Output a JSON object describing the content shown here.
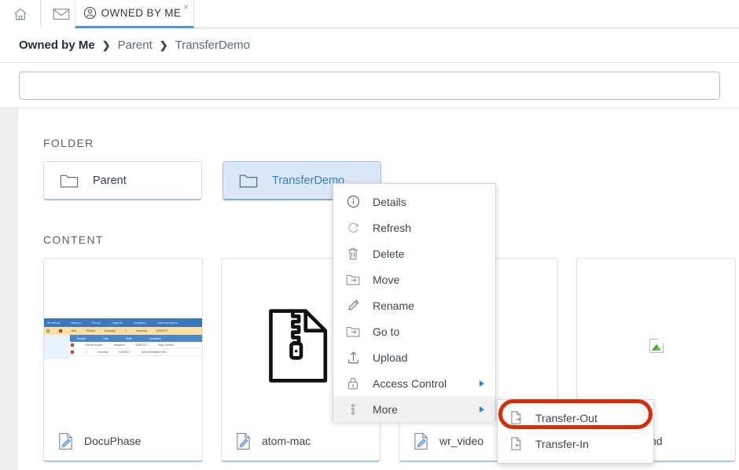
{
  "tabbar": {
    "home_icon": "home-icon",
    "mail_icon": "envelope-icon",
    "active_tab": {
      "icon": "user-circle-icon",
      "label": "OWNED BY ME",
      "close": "×"
    }
  },
  "breadcrumb": {
    "items": [
      "Owned by Me",
      "Parent",
      "TransferDemo"
    ],
    "separator": "❯"
  },
  "search": {
    "value": "",
    "placeholder": ""
  },
  "sections": {
    "folder_title": "FOLDER",
    "content_title": "CONTENT"
  },
  "folders": [
    {
      "name": "Parent",
      "icon": "folder-icon",
      "selected": false
    },
    {
      "name": "TransferDemo",
      "icon": "folder-icon",
      "selected": true
    }
  ],
  "content_items": [
    {
      "name": "DocuPhase",
      "icon": "document-edit-icon",
      "thumb": "screenshot-thumbnail"
    },
    {
      "name": "atom-mac",
      "icon": "document-edit-icon",
      "thumb": "zip-file-icon"
    },
    {
      "name": "wr_video",
      "icon": "document-edit-icon",
      "thumb": "none"
    },
    {
      "name": "ckground",
      "icon": "document-edit-icon",
      "thumb": "broken-image-icon"
    }
  ],
  "thumbnail": {
    "nav_items": [
      "Workflow",
      "Search",
      "Forms",
      "Capture",
      "Analytics",
      "Administration"
    ],
    "highlight_row": [
      "Add",
      "TATest3",
      "Drawings",
      "1",
      "Incoming",
      "6/26/2017",
      "1"
    ],
    "table_headers": [
      "Version",
      "User",
      "Date",
      "Comment"
    ],
    "table_rows": [
      [
        "Current Version",
        "sysadmin",
        "6/26/2017",
        "Auto CheckIn"
      ],
      [
        "1",
        "Incoming",
        "6/26/2017",
        "Auto Generated Versi."
      ]
    ]
  },
  "context_menu": {
    "items": [
      {
        "label": "Details",
        "icon": "info-circle-icon",
        "submenu": false,
        "active": false
      },
      {
        "label": "Refresh",
        "icon": "refresh-icon",
        "submenu": false,
        "active": false
      },
      {
        "label": "Delete",
        "icon": "trash-icon",
        "submenu": false,
        "active": false
      },
      {
        "label": "Move",
        "icon": "folder-arrow-icon",
        "submenu": false,
        "active": false
      },
      {
        "label": "Rename",
        "icon": "pencil-icon",
        "submenu": false,
        "active": false
      },
      {
        "label": "Go to",
        "icon": "folder-arrow-icon",
        "submenu": false,
        "active": false
      },
      {
        "label": "Upload",
        "icon": "upload-icon",
        "submenu": false,
        "active": false
      },
      {
        "label": "Access Control",
        "icon": "lock-icon",
        "submenu": true,
        "active": false
      },
      {
        "label": "More",
        "icon": "vertical-dots-icon",
        "submenu": true,
        "active": true
      }
    ]
  },
  "submenu": {
    "items": [
      {
        "label": "Transfer-Out",
        "icon": "document-out-icon",
        "highlighted": true
      },
      {
        "label": "Transfer-In",
        "icon": "document-in-icon",
        "highlighted": false
      }
    ]
  },
  "colors": {
    "accent_blue": "#2f7ec4",
    "tab_underline": "#4f9ad4",
    "selected_folder_bg": "#dce8f9",
    "highlight_red": "#d82b08",
    "card_bottom_border": "#a9c6e6"
  }
}
